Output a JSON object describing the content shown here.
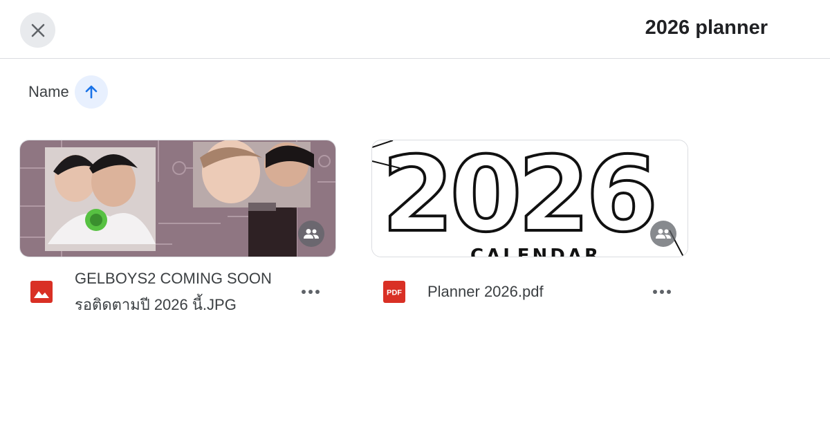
{
  "header": {
    "title": "2026 planner",
    "close_icon": "close-icon"
  },
  "sort": {
    "label": "Name",
    "direction_icon": "arrow-up-icon",
    "accent_color": "#1a73e8"
  },
  "files": [
    {
      "name_line1": "GELBOYS2 COMING SOON",
      "name_line2": "รอติดตามปี 2026 นี้.JPG",
      "type_icon": "image-file-icon",
      "type_color": "#d93025",
      "shared": true,
      "shared_icon": "people-icon",
      "more_icon": "more-horizontal-icon"
    },
    {
      "name_line1": "Planner 2026.pdf",
      "type_icon": "pdf-file-icon",
      "type_label": "PDF",
      "type_color": "#d93025",
      "shared": true,
      "shared_icon": "people-icon",
      "more_icon": "more-horizontal-icon",
      "thumbnail_text": "2026",
      "thumbnail_subtext": "CALENDAR"
    }
  ]
}
